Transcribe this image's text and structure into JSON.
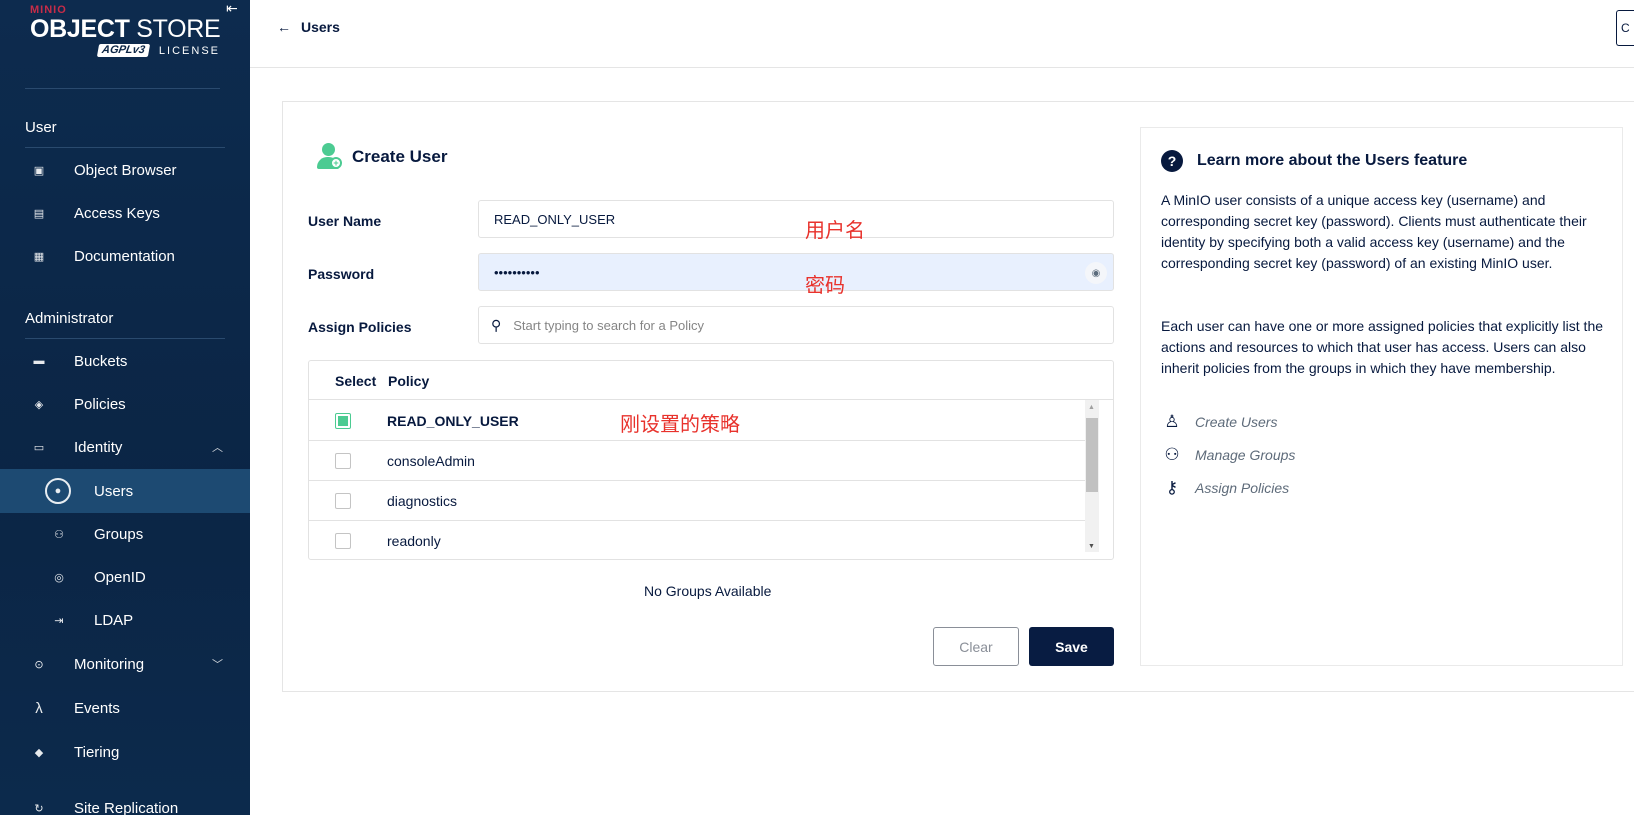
{
  "sidebar": {
    "logo": {
      "brand_small": "MINIO",
      "brand_object": "OBJECT",
      "brand_store": "STORE",
      "agpl": "AGPLv3",
      "license": "LICENSE"
    },
    "collapse_icon": "collapse-left-icon",
    "sections": {
      "user": "User",
      "admin": "Administrator"
    },
    "items": [
      {
        "label": "Object Browser",
        "icon": "folder-icon"
      },
      {
        "label": "Access Keys",
        "icon": "key-card-icon"
      },
      {
        "label": "Documentation",
        "icon": "docs-icon"
      },
      {
        "label": "Buckets",
        "icon": "bucket-icon"
      },
      {
        "label": "Policies",
        "icon": "shield-icon"
      },
      {
        "label": "Identity",
        "icon": "id-card-icon"
      },
      {
        "label": "Users",
        "icon": "user-circle-icon"
      },
      {
        "label": "Groups",
        "icon": "group-icon"
      },
      {
        "label": "OpenID",
        "icon": "openid-icon"
      },
      {
        "label": "LDAP",
        "icon": "login-icon"
      },
      {
        "label": "Monitoring",
        "icon": "monitor-search-icon"
      },
      {
        "label": "Events",
        "icon": "lambda-icon"
      },
      {
        "label": "Tiering",
        "icon": "layers-icon"
      },
      {
        "label": "Site Replication",
        "icon": "sync-icon"
      }
    ]
  },
  "topbar": {
    "back_label": "Users",
    "right_button": "C"
  },
  "form": {
    "title": "Create User",
    "username_label": "User Name",
    "username_value": "READ_ONLY_USER",
    "password_label": "Password",
    "password_value": "••••••••••",
    "policies_label": "Assign Policies",
    "policies_placeholder": "Start typing to search for a Policy",
    "table": {
      "header_select": "Select",
      "header_policy": "Policy",
      "rows": [
        {
          "name": "READ_ONLY_USER",
          "checked": true
        },
        {
          "name": "consoleAdmin",
          "checked": false
        },
        {
          "name": "diagnostics",
          "checked": false
        },
        {
          "name": "readonly",
          "checked": false
        }
      ]
    },
    "no_groups": "No Groups Available",
    "clear_label": "Clear",
    "save_label": "Save"
  },
  "annotations": {
    "username": "用户名",
    "password": "密码",
    "policy": "刚设置的策略"
  },
  "help": {
    "title": "Learn more about the Users feature",
    "p1": "A MinIO user consists of a unique access key (username) and corresponding secret key (password). Clients must authenticate their identity by specifying both a valid access key (username) and the corresponding secret key (password) of an existing MinIO user.",
    "p2": "Each user can have one or more assigned policies that explicitly list the actions and resources to which that user has access. Users can also inherit policies from the groups in which they have membership.",
    "links": [
      {
        "label": "Create Users",
        "icon": "user-outline-icon"
      },
      {
        "label": "Manage Groups",
        "icon": "group-outline-icon"
      },
      {
        "label": "Assign Policies",
        "icon": "key-icon"
      }
    ]
  },
  "colors": {
    "sidebar_bg": "#0b2545",
    "active_item": "#1d4a72",
    "accent_green": "#4ccb92",
    "save_button": "#081c42",
    "annotation_red": "#e8322c"
  }
}
